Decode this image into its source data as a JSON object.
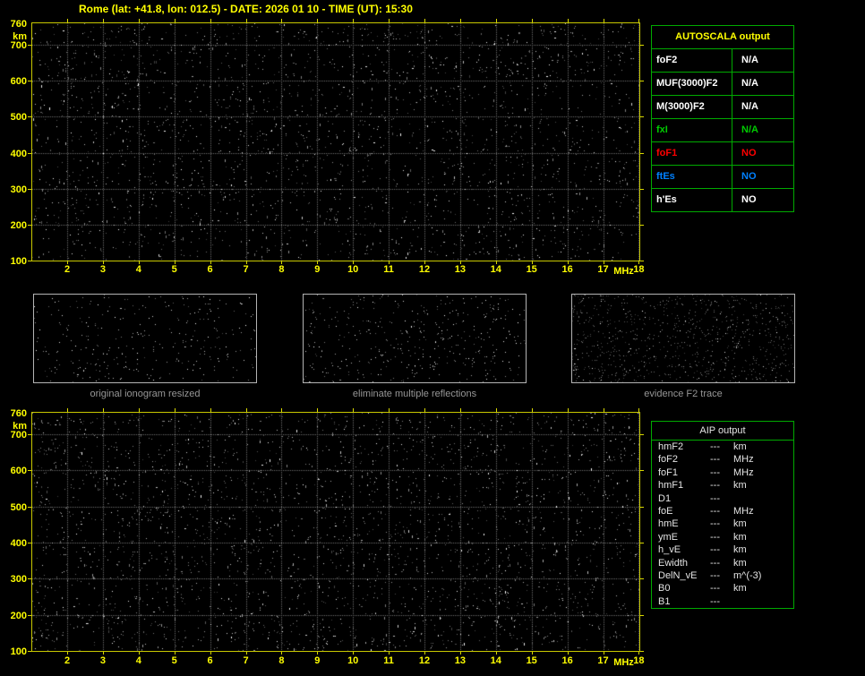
{
  "title": "Rome (lat: +41.8, lon: 012.5) - DATE: 2026 01 10 - TIME (UT): 15:30",
  "colors": {
    "background": "#000000",
    "axis_yellow": "#ffff00",
    "plot_border": "#c8c800",
    "table_border": "#00aa00",
    "caption_gray": "#969696",
    "white": "#ffffff",
    "green_value": "#00cc00",
    "red_value": "#ff0000",
    "blue_value": "#0080ff"
  },
  "ionogram": {
    "x_unit": "MHz",
    "y_unit": "km",
    "x_ticks": [
      "2",
      "3",
      "4",
      "5",
      "6",
      "7",
      "8",
      "9",
      "10",
      "11",
      "12",
      "13",
      "14",
      "15",
      "16",
      "17",
      "18"
    ],
    "y_ticks": [
      "760",
      "700",
      "600",
      "500",
      "400",
      "300",
      "200",
      "100"
    ],
    "x_range_mhz": [
      2,
      18
    ],
    "y_range_km": [
      100,
      760
    ]
  },
  "autoscala": {
    "header": "AUTOSCALA output",
    "rows": [
      {
        "label": "foF2",
        "value": "N/A",
        "color": "#ffffff"
      },
      {
        "label": "MUF(3000)F2",
        "value": "N/A",
        "color": "#ffffff"
      },
      {
        "label": "M(3000)F2",
        "value": "N/A",
        "color": "#ffffff"
      },
      {
        "label": "fxI",
        "value": "N/A",
        "color": "#00cc00"
      },
      {
        "label": "foF1",
        "value": "NO",
        "color": "#ff0000"
      },
      {
        "label": "ftEs",
        "value": "NO",
        "color": "#0080ff"
      },
      {
        "label": "h'Es",
        "value": "NO",
        "color": "#ffffff"
      }
    ]
  },
  "thumbnails": [
    {
      "caption": "original ionogram resized"
    },
    {
      "caption": "eliminate multiple reflections"
    },
    {
      "caption": "evidence F2 trace"
    }
  ],
  "aip": {
    "header": "AIP output",
    "rows": [
      {
        "label": "hmF2",
        "value": "---",
        "unit": "km"
      },
      {
        "label": "foF2",
        "value": "---",
        "unit": "MHz"
      },
      {
        "label": "foF1",
        "value": "---",
        "unit": "MHz"
      },
      {
        "label": "hmF1",
        "value": "---",
        "unit": "km"
      },
      {
        "label": "D1",
        "value": "---",
        "unit": ""
      },
      {
        "label": "foE",
        "value": "---",
        "unit": "MHz"
      },
      {
        "label": "hmE",
        "value": "---",
        "unit": "km"
      },
      {
        "label": "ymE",
        "value": "---",
        "unit": "km"
      },
      {
        "label": "h_vE",
        "value": "---",
        "unit": "km"
      },
      {
        "label": "Ewidth",
        "value": "---",
        "unit": "km"
      },
      {
        "label": "DelN_vE",
        "value": "---",
        "unit": "m^(-3)"
      },
      {
        "label": "B0",
        "value": "---",
        "unit": "km"
      },
      {
        "label": "B1",
        "value": "---",
        "unit": ""
      }
    ]
  }
}
